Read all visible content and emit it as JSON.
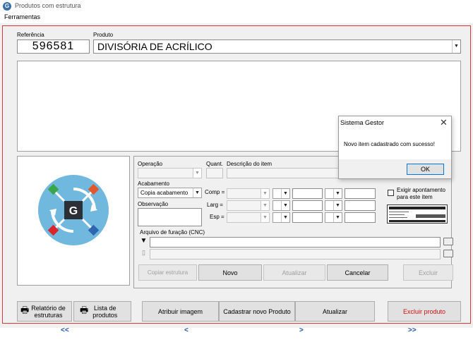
{
  "window": {
    "title": "Produtos com estrutura",
    "icon_letter": "G"
  },
  "menu": {
    "ferramentas": "Ferramentas"
  },
  "header": {
    "referencia_label": "Referência",
    "referencia_value": "596581",
    "produto_label": "Produto",
    "produto_value": "DIVISÓRIA DE ACRÍLICO"
  },
  "logo": {
    "letter": "G"
  },
  "form": {
    "operacao_label": "Operação",
    "quant_label": "Quant.",
    "descricao_label": "Descrição do item",
    "acabamento_label": "Acabamento",
    "acabamento_value": "Copia acabamento",
    "observacao_label": "Observação",
    "comp_label": "Comp =",
    "larg_label": "Larg =",
    "esp_label": "Esp =",
    "exigir_label_line1": "Exigir apontamento",
    "exigir_label_line2": "para este item",
    "arquivo_label": "Arquivo de furação (CNC)"
  },
  "form_buttons": {
    "copiar": "Copiar estrutura",
    "novo": "Novo",
    "atualizar": "Atualizar",
    "cancelar": "Cancelar",
    "excluir": "Excluir"
  },
  "bottom_buttons": {
    "relatorio_line1": "Relatório de",
    "relatorio_line2": "estruturas",
    "lista_line1": "Lista de",
    "lista_line2": "produtos",
    "atribuir": "Atribuir imagem",
    "cadastrar": "Cadastrar novo Produto",
    "atualizar": "Atualizar",
    "excluir_produto": "Excluir produto"
  },
  "nav": {
    "first": "<<",
    "prev": "<",
    "next": ">",
    "last": ">>"
  },
  "dialog": {
    "title": "Sistema Gestor",
    "message": "Novo item cadastrado com sucesso!",
    "ok": "OK"
  },
  "colors": {
    "accent_red": "#cc1111",
    "nav_blue": "#1a4fa0",
    "border_red": "#d03a3a"
  }
}
